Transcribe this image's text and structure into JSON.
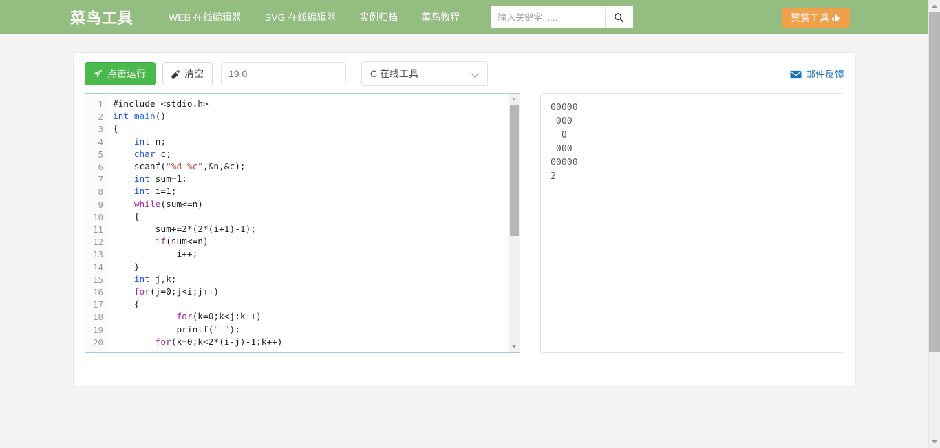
{
  "navbar": {
    "brand": "菜鸟工具",
    "links": [
      {
        "label": "WEB 在线编辑器"
      },
      {
        "label": "SVG 在线编辑器"
      },
      {
        "label": "实例归档"
      },
      {
        "label": "菜鸟教程"
      }
    ],
    "search": {
      "placeholder": "输入关键字......",
      "value": "",
      "icon": "search-icon"
    },
    "donate": {
      "label": "赞赏工具",
      "icon": "thumbs-up-icon",
      "color": "#f0a04b"
    },
    "bg_color": "#93bd81"
  },
  "toolbar": {
    "run": {
      "label": "点击运行",
      "icon": "paper-plane-icon",
      "color": "#4cb94c"
    },
    "clear": {
      "label": "清空",
      "icon": "eraser-icon"
    },
    "stdin": {
      "value": "19 0",
      "placeholder": ""
    },
    "language": {
      "selected": "C 在线工具",
      "icon": "chevron-down-icon",
      "options": [
        "C 在线工具"
      ]
    },
    "feedback": {
      "label": "邮件反馈",
      "icon": "envelope-icon",
      "color": "#1a74b8"
    }
  },
  "editor": {
    "first_visible_line": 1,
    "last_visible_line": 20,
    "line_numbers": [
      "1",
      "2",
      "3",
      "4",
      "5",
      "6",
      "7",
      "8",
      "9",
      "10",
      "11",
      "12",
      "13",
      "14",
      "15",
      "16",
      "17",
      "18",
      "19",
      "20"
    ],
    "lines": [
      {
        "n": "1",
        "html": "<span class=\"tok-pre\">#include &lt;stdio.h&gt;</span>"
      },
      {
        "n": "2",
        "html": "<span class=\"tok-type\">int</span> <span class=\"tok-fn\">main</span>()"
      },
      {
        "n": "3",
        "html": "{"
      },
      {
        "n": "4",
        "html": "    <span class=\"tok-type\">int</span> n;"
      },
      {
        "n": "5",
        "html": "    <span class=\"tok-type\">char</span> c;"
      },
      {
        "n": "6",
        "html": "    scanf(<span class=\"tok-str\">\"%d %c\"</span>,&amp;n,&amp;c);"
      },
      {
        "n": "7",
        "html": "    <span class=\"tok-type\">int</span> sum=1;"
      },
      {
        "n": "8",
        "html": "    <span class=\"tok-type\">int</span> i=1;"
      },
      {
        "n": "9",
        "html": "    <span class=\"tok-kw\">while</span>(sum&lt;=n)"
      },
      {
        "n": "10",
        "html": "    {"
      },
      {
        "n": "11",
        "html": "        sum+=2*(2*(i+1)-1);"
      },
      {
        "n": "12",
        "html": "        <span class=\"tok-kw\">if</span>(sum&lt;=n)"
      },
      {
        "n": "13",
        "html": "            i++;"
      },
      {
        "n": "14",
        "html": "    }"
      },
      {
        "n": "15",
        "html": "    <span class=\"tok-type\">int</span> j,k;"
      },
      {
        "n": "16",
        "html": "    <span class=\"tok-kw\">for</span>(j=0;j&lt;i;j++)"
      },
      {
        "n": "17",
        "html": "    {"
      },
      {
        "n": "18",
        "html": "            <span class=\"tok-kw\">for</span>(k=0;k&lt;j;k++)"
      },
      {
        "n": "19",
        "html": "            printf(<span class=\"tok-str\">\" \"</span>);"
      },
      {
        "n": "20",
        "html": "        <span class=\"tok-kw\">for</span>(k=0;k&lt;2*(i-j)-1;k++)"
      }
    ]
  },
  "output": {
    "lines": [
      "00000",
      " 000",
      "  0",
      " 000",
      "00000",
      "2"
    ]
  }
}
